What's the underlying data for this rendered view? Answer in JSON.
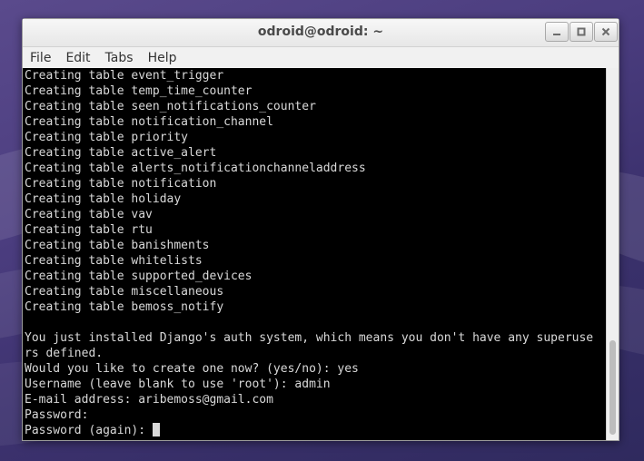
{
  "window": {
    "title": "odroid@odroid: ~",
    "controls": {
      "minimize_icon": "minimize-icon",
      "maximize_icon": "maximize-icon",
      "close_icon": "close-icon"
    }
  },
  "menubar": {
    "items": [
      {
        "label": "File"
      },
      {
        "label": "Edit"
      },
      {
        "label": "Tabs"
      },
      {
        "label": "Help"
      }
    ]
  },
  "terminal": {
    "lines": [
      "Creating table event_trigger",
      "Creating table temp_time_counter",
      "Creating table seen_notifications_counter",
      "Creating table notification_channel",
      "Creating table priority",
      "Creating table active_alert",
      "Creating table alerts_notificationchanneladdress",
      "Creating table notification",
      "Creating table holiday",
      "Creating table vav",
      "Creating table rtu",
      "Creating table banishments",
      "Creating table whitelists",
      "Creating table supported_devices",
      "Creating table miscellaneous",
      "Creating table bemoss_notify",
      "",
      "You just installed Django's auth system, which means you don't have any superuse",
      "rs defined.",
      "Would you like to create one now? (yes/no): yes",
      "Username (leave blank to use 'root'): admin",
      "E-mail address: aribemoss@gmail.com",
      "Password:",
      "Password (again): "
    ]
  },
  "colors": {
    "terminal_bg": "#000000",
    "terminal_fg": "#d9d9d9",
    "desktop_bg": "#4b3d7f"
  }
}
